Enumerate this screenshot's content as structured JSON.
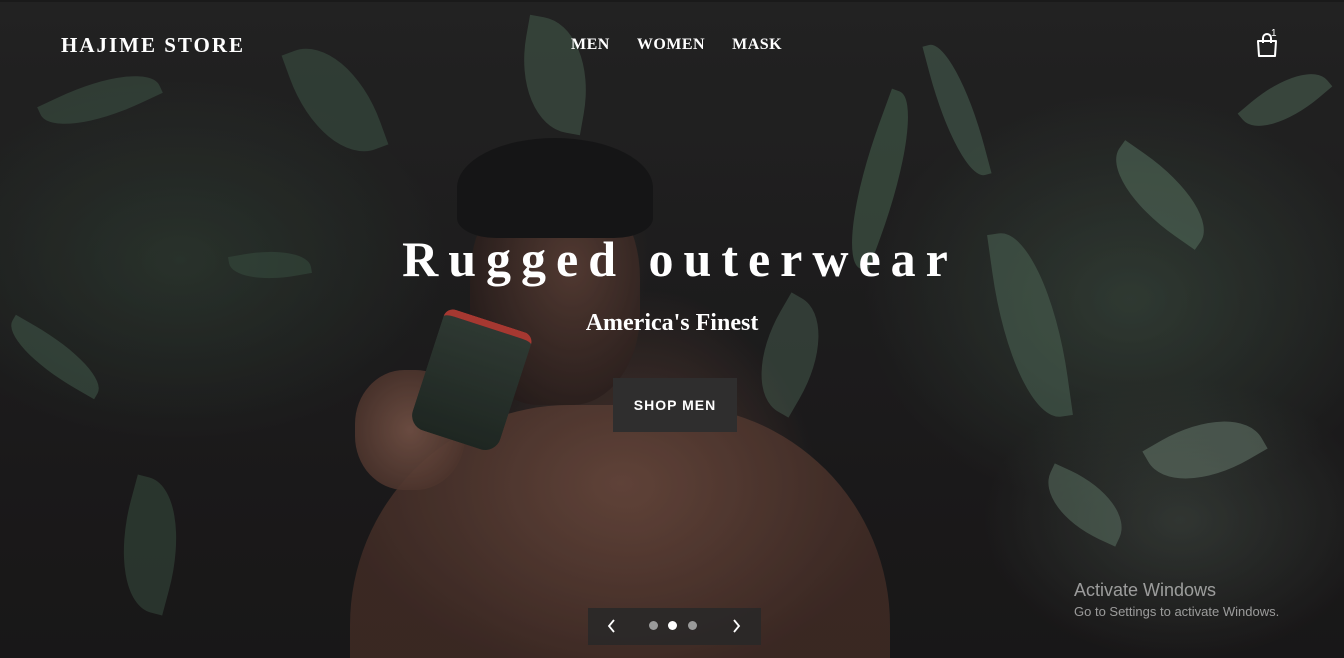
{
  "header": {
    "logo": "HAJIME STORE",
    "nav": [
      {
        "label": "MEN"
      },
      {
        "label": "WOMEN"
      },
      {
        "label": "MASK"
      }
    ],
    "cart_count": "1",
    "cart_icon": "shopping-bag-icon"
  },
  "hero": {
    "title": "Rugged outerwear",
    "subtitle": "America's Finest",
    "button_label": "SHOP MEN"
  },
  "slider": {
    "prev_icon": "chevron-left-icon",
    "next_icon": "chevron-right-icon",
    "slide_count": 3,
    "active_index": 1
  },
  "watermark": {
    "title": "Activate Windows",
    "subtitle": "Go to Settings to activate Windows."
  },
  "colors": {
    "button_bg": "#2f2e2e",
    "text": "#ffffff",
    "dot_active": "#ffffff",
    "dot_inactive": "#9a9a9a"
  }
}
